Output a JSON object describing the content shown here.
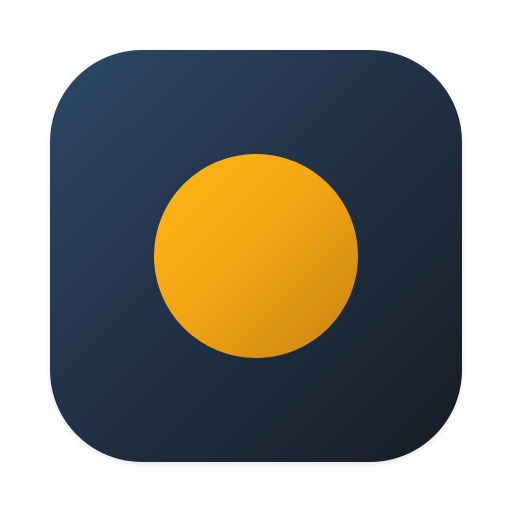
{
  "icon": {
    "name": "circle-app-icon",
    "background_colors": [
      "#2e4965",
      "#223248",
      "#171c24"
    ],
    "dot_colors": [
      "#ffb811",
      "#f4a615",
      "#c88411"
    ]
  }
}
